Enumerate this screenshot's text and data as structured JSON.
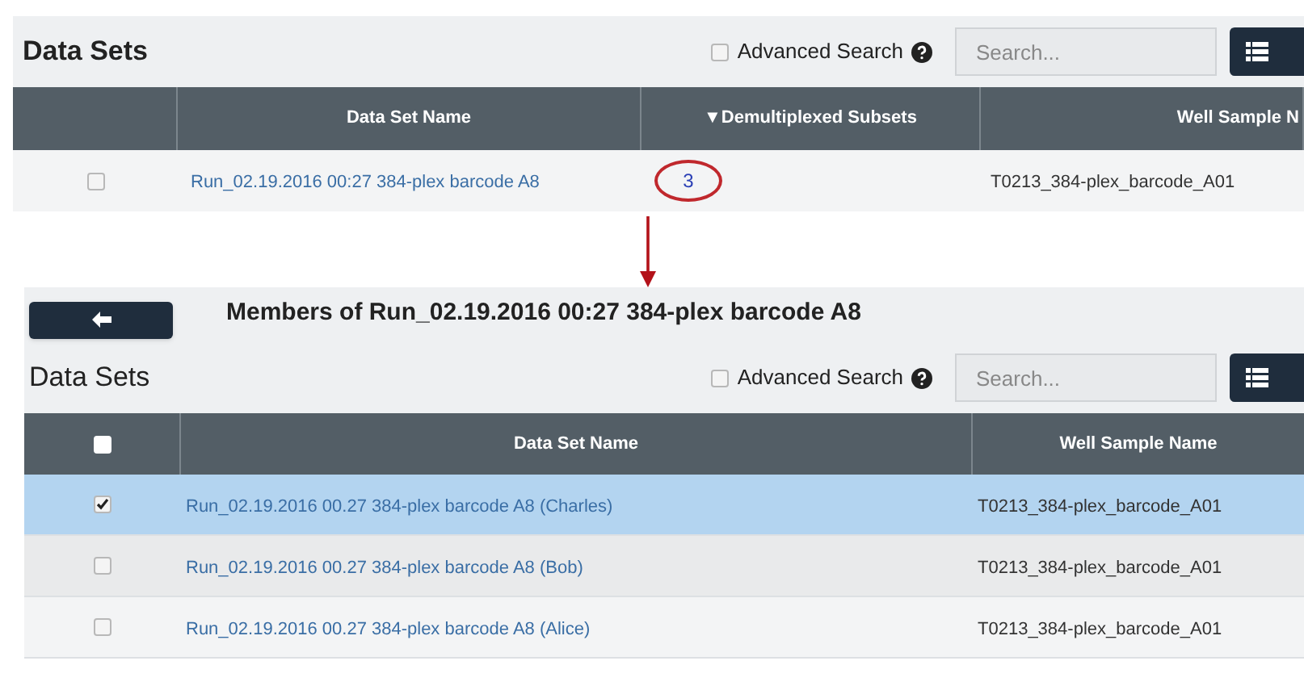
{
  "top_panel": {
    "title": "Data Sets",
    "advanced_search": {
      "label": "Advanced Search",
      "checked": false
    },
    "search": {
      "placeholder": "Search..."
    },
    "table": {
      "columns": [
        "",
        "Data Set Name",
        "▼Demultiplexed Subsets",
        "Well Sample N"
      ],
      "rows": [
        {
          "selected": false,
          "cells": [
            "",
            "Run_02.19.2016 00:27 384-plex barcode A8",
            "3",
            "T0213_384-plex_barcode_A01"
          ]
        }
      ]
    }
  },
  "detail_panel": {
    "heading": "Members of Run_02.19.2016 00:27 384-plex barcode A8",
    "title": "Data Sets",
    "advanced_search": {
      "label": "Advanced Search",
      "checked": false
    },
    "search": {
      "placeholder": "Search..."
    },
    "table": {
      "select_all": {
        "checked": false
      },
      "columns": [
        "Data Set Name",
        "Well Sample Name"
      ],
      "rows": [
        {
          "selected": true,
          "cells": [
            "Run_02.19.2016 00.27 384-plex barcode A8 (Charles)",
            "T0213_384-plex_barcode_A01"
          ]
        },
        {
          "selected": false,
          "cells": [
            "Run_02.19.2016 00.27 384-plex barcode A8 (Bob)",
            "T0213_384-plex_barcode_A01"
          ]
        },
        {
          "selected": false,
          "cells": [
            "Run_02.19.2016 00.27 384-plex barcode A8 (Alice)",
            "T0213_384-plex_barcode_A01"
          ]
        }
      ]
    }
  }
}
